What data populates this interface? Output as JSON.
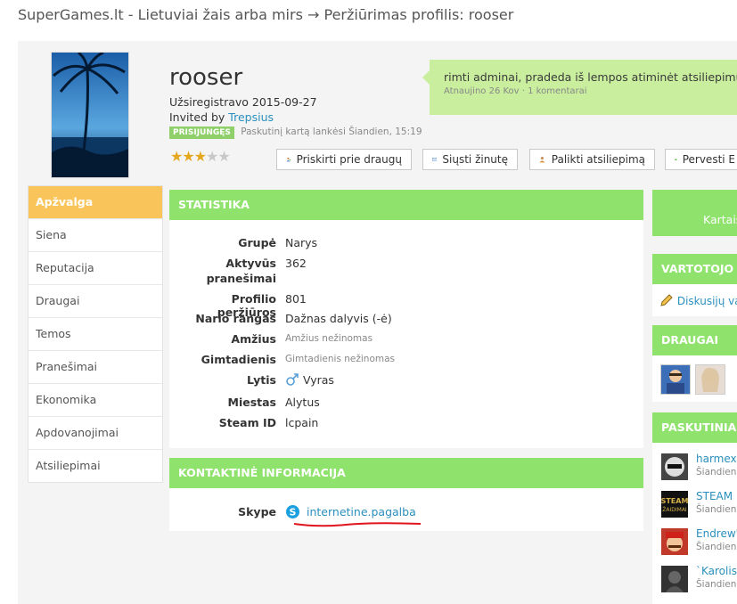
{
  "page": {
    "title": "SuperGames.lt - Lietuviai žais arba mirs  →  Peržiūrimas profilis: rooser"
  },
  "profile": {
    "username": "rooser",
    "registered_label": "Užsiregistravo",
    "registered_date": "2015-09-27",
    "invited_label": "Invited by",
    "invited_by": "Trepsius",
    "online_badge": "PRISIJUNGĘS",
    "last_visit": "Paskutinį kartą lankėsi Šiandien, 15:19",
    "rating_stars": 3,
    "rating_max": 5,
    "status": {
      "text": "rimti adminai, pradeda iš lempos atiminėt atsiliepimus.",
      "meta": "Atnaujino 26 Kov · 1 komentarai"
    }
  },
  "actions": {
    "add_friend": "Priskirti prie draugų",
    "send_message": "Siųsti žinutę",
    "leave_feedback": "Palikti atsiliepimą",
    "transfer": "Pervesti E"
  },
  "sidebar": {
    "items": [
      {
        "label": "Apžvalga",
        "active": true
      },
      {
        "label": "Siena"
      },
      {
        "label": "Reputacija"
      },
      {
        "label": "Draugai"
      },
      {
        "label": "Temos"
      },
      {
        "label": "Pranešimai"
      },
      {
        "label": "Ekonomika"
      },
      {
        "label": "Apdovanojimai"
      },
      {
        "label": "Atsiliepimai"
      }
    ]
  },
  "stats": {
    "heading": "STATISTIKA",
    "rows": [
      {
        "label": "Grupė",
        "value": "Narys"
      },
      {
        "label": "Aktyvūs pranešimai",
        "value": "362"
      },
      {
        "label": "Profilio peržiūros",
        "value": "801"
      },
      {
        "label": "Nario rangas",
        "value": "Dažnas dalyvis (-ė)"
      },
      {
        "label": "Amžius",
        "value": "Amžius nežinomas"
      },
      {
        "label": "Gimtadienis",
        "value": "Gimtadienis nežinomas"
      },
      {
        "label": "Lytis",
        "value": "Vyras"
      },
      {
        "label": "Miestas",
        "value": "Alytus"
      },
      {
        "label": "Steam ID",
        "value": "lcpain"
      }
    ]
  },
  "contact": {
    "heading": "KONTAKTINĖ INFORMACIJA",
    "skype_label": "Skype",
    "skype_value": "internetine.pagalba"
  },
  "right": {
    "box1_text": "Kartais",
    "user_heading": "VARTOTOJO N",
    "discussion_link": "Diskusijų va",
    "friends_heading": "DRAUGAI",
    "latest_heading": "PASKUTINIAI I",
    "latest": [
      {
        "name": "harmex",
        "sub": "Šiandien,"
      },
      {
        "name": "STEAM",
        "sub": "Šiandien,"
      },
      {
        "name": "Endrew'",
        "sub": "Šiandien,"
      },
      {
        "name": "`Karolis.",
        "sub": "Šiandien,"
      }
    ]
  },
  "colors": {
    "accent_green": "#8fe26c",
    "status_green": "#c8ee9e",
    "active_tab": "#f9c55a",
    "link": "#2a8fbd",
    "annotation": "#e0141c"
  }
}
